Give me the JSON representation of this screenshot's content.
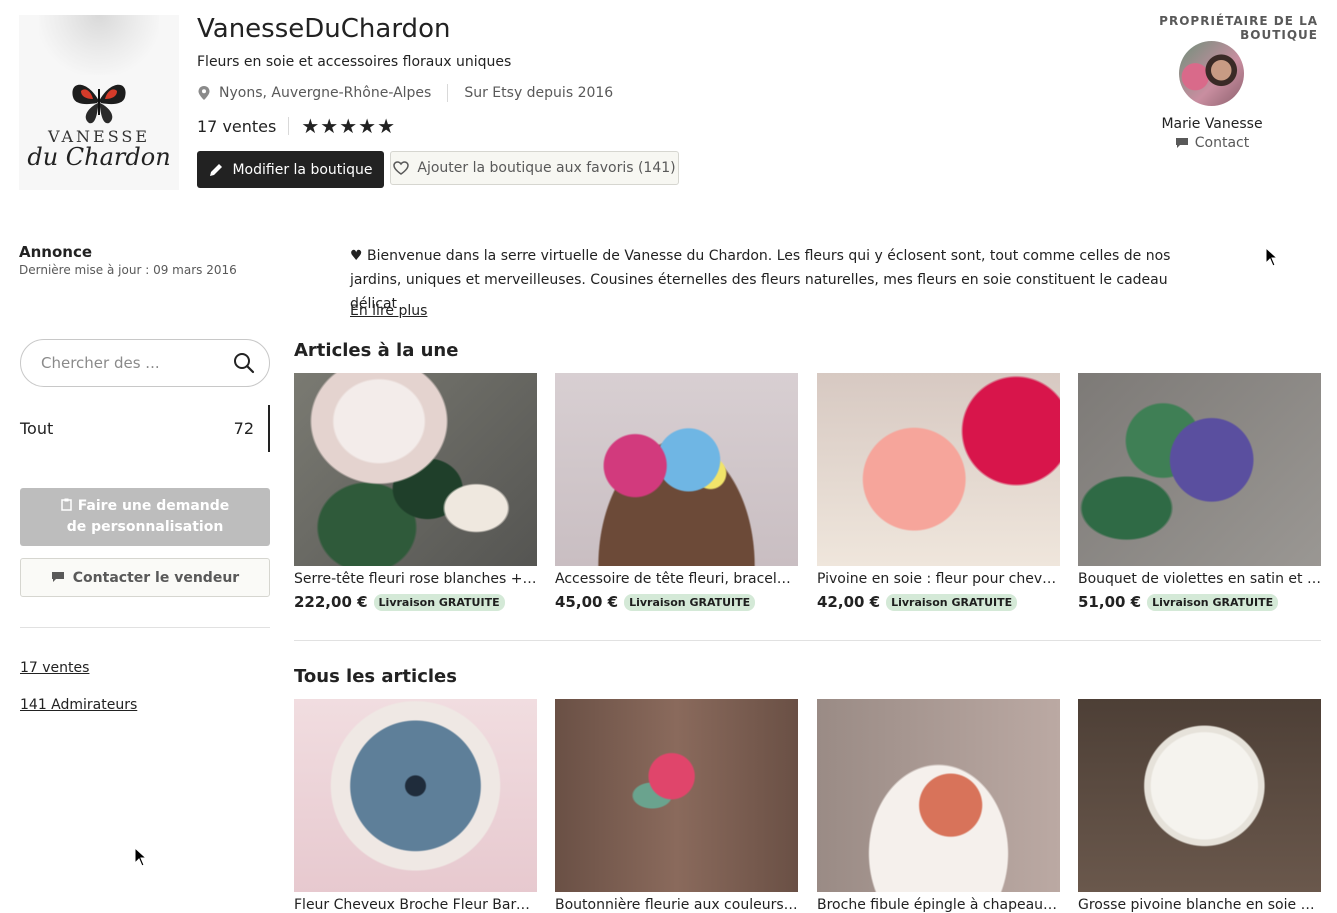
{
  "shop": {
    "logo_line1": "VANESSE",
    "logo_line2": "du Chardon",
    "name": "VanesseDuChardon",
    "tagline": "Fleurs en soie et accessoires floraux uniques",
    "location": "Nyons, Auvergne-Rhône-Alpes",
    "since": "Sur Etsy depuis 2016",
    "sales": "17 ventes",
    "stars": "★★★★★",
    "rating": 5,
    "edit_label": "Modifier la boutique",
    "favorite_label": "Ajouter la boutique aux favoris (141)"
  },
  "owner": {
    "label": "PROPRIÉTAIRE DE LA BOUTIQUE",
    "name": "Marie Vanesse",
    "contact": "Contact"
  },
  "announcement": {
    "title": "Annonce",
    "updated": "Dernière mise à jour : 09 mars 2016",
    "text": "♥ Bienvenue dans la serre virtuelle de Vanesse du Chardon. Les fleurs qui y éclosent sont, tout comme celles de nos jardins, uniques et merveilleuses. Cousines éternelles des fleurs naturelles, mes fleurs en soie constituent le cadeau délicat",
    "read_more": "En lire plus"
  },
  "sidebar": {
    "search_placeholder": "Chercher des ...",
    "category": "Tout",
    "category_count": "72",
    "custom_request": "Faire une demande de personnalisation",
    "contact_seller": "Contacter le vendeur",
    "sales_link": "17 ventes",
    "admirers_link": "141 Admirateurs"
  },
  "featured": {
    "title": "Articles à la une",
    "items": [
      {
        "title": "Serre-tête fleuri rose blanches + b...",
        "price": "222,00 €",
        "badge": "Livraison GRATUITE"
      },
      {
        "title": "Accessoire de tête fleuri, bracelet ...",
        "price": "45,00 €",
        "badge": "Livraison GRATUITE"
      },
      {
        "title": "Pivoine en soie : fleur pour cheveu...",
        "price": "42,00 €",
        "badge": "Livraison GRATUITE"
      },
      {
        "title": "Bouquet de violettes en satin et so...",
        "price": "51,00 €",
        "badge": "Livraison GRATUITE"
      }
    ]
  },
  "all_items": {
    "title": "Tous les articles",
    "items": [
      {
        "title": "Fleur Cheveux Broche Fleur Barett..."
      },
      {
        "title": "Boutonnière fleurie aux couleurs v..."
      },
      {
        "title": "Broche fibule épingle à chapeau b..."
      },
      {
        "title": "Grosse pivoine blanche en soie po..."
      }
    ]
  }
}
